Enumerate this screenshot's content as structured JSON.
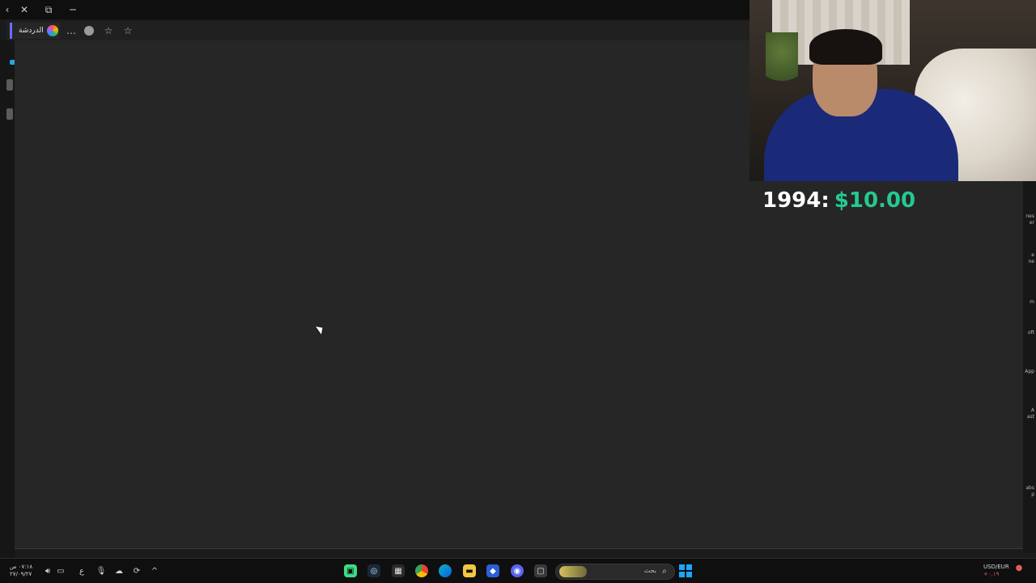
{
  "browser": {
    "tab_label": "الدردشة",
    "more_icon": "…",
    "window_controls": {
      "close": "✕",
      "restore": "⧉",
      "minimize": "─"
    }
  },
  "overlay": {
    "year": "1994:",
    "price": "$10.00"
  },
  "right_strip_fragments": [
    "nes",
    "er",
    "e",
    "ne",
    "m",
    "oft",
    "App",
    "A",
    "ast",
    "abs",
    "p"
  ],
  "taskbar": {
    "clock_time": "٠٧:١٨ ص",
    "clock_date": "٢٧/٠٩/٢٧",
    "language": "ع",
    "search_placeholder": "بحث",
    "currency_ticker": "USD/EUR",
    "currency_value": "+٠,١٩"
  },
  "colors": {
    "price_green": "#25c98f",
    "accent_blue": "#1aa7ff",
    "background": "#262626"
  }
}
